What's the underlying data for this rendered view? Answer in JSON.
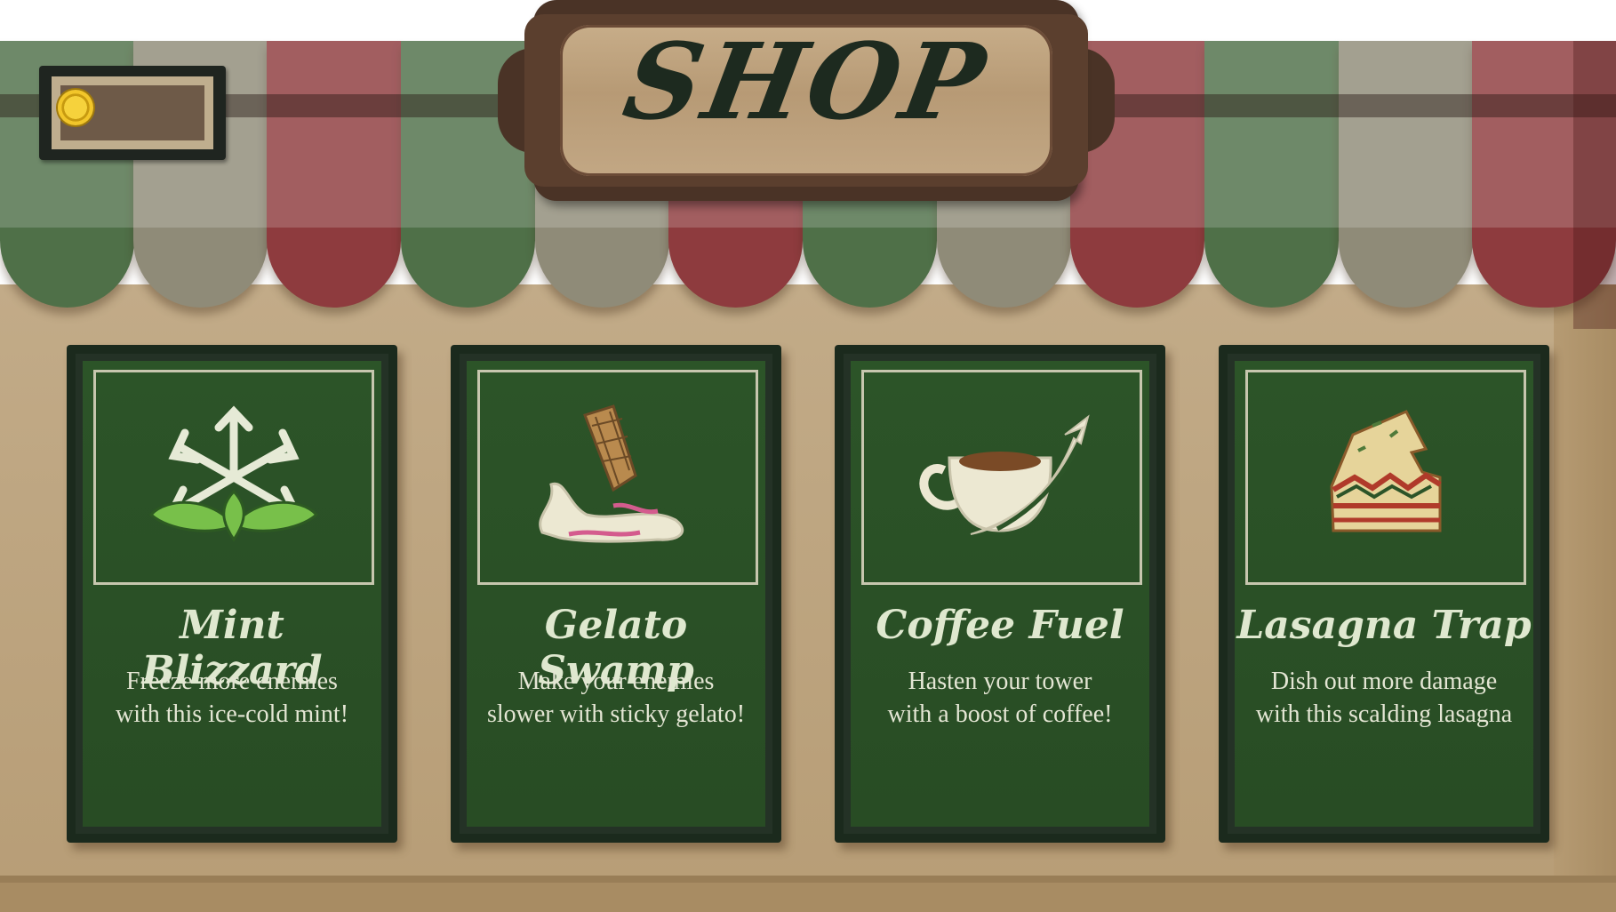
{
  "header": {
    "title": "SHOP"
  },
  "wallet": {
    "amount": "",
    "icon": "coin-icon"
  },
  "colors": {
    "awning_green": "#4f7048",
    "awning_grey": "#8f8b78",
    "awning_red": "#8e3b3e",
    "card_green": "#2c5428",
    "counter": "#c2ab88"
  },
  "items": [
    {
      "name": "Mint Blizzard",
      "description_line1": "Freeze more enemies",
      "description_line2": "with this ice-cold mint!",
      "icon": "mint-snowflake-icon"
    },
    {
      "name": "Gelato Swamp",
      "description_line1": "Make your enemies",
      "description_line2": "slower with sticky gelato!",
      "icon": "gelato-cone-icon"
    },
    {
      "name": "Coffee Fuel",
      "description_line1": "Hasten your tower",
      "description_line2": "with a boost of coffee!",
      "icon": "coffee-cup-icon"
    },
    {
      "name": "Lasagna Trap",
      "description_line1": "Dish out more damage",
      "description_line2": "with this scalding lasagna",
      "icon": "lasagna-slice-icon"
    }
  ]
}
